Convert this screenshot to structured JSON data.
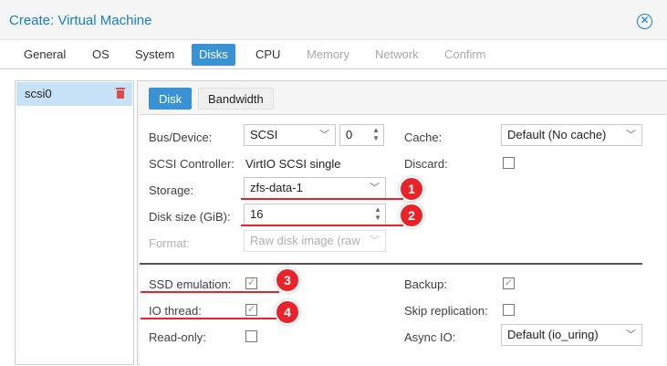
{
  "window": {
    "title": "Create: Virtual Machine"
  },
  "tabs": [
    {
      "label": "General",
      "state": "normal"
    },
    {
      "label": "OS",
      "state": "normal"
    },
    {
      "label": "System",
      "state": "normal"
    },
    {
      "label": "Disks",
      "state": "active"
    },
    {
      "label": "CPU",
      "state": "normal"
    },
    {
      "label": "Memory",
      "state": "disabled"
    },
    {
      "label": "Network",
      "state": "disabled"
    },
    {
      "label": "Confirm",
      "state": "disabled"
    }
  ],
  "disk_list": {
    "items": [
      {
        "label": "scsi0"
      }
    ]
  },
  "subtabs": [
    {
      "label": "Disk"
    },
    {
      "label": "Bandwidth"
    }
  ],
  "form": {
    "bus_device": {
      "label": "Bus/Device:",
      "bus": "SCSI",
      "device": "0"
    },
    "scsi_controller": {
      "label": "SCSI Controller:",
      "value": "VirtIO SCSI single"
    },
    "storage": {
      "label": "Storage:",
      "value": "zfs-data-1"
    },
    "disk_size": {
      "label": "Disk size (GiB):",
      "value": "16"
    },
    "format": {
      "label": "Format:",
      "value": "Raw disk image (raw"
    },
    "cache": {
      "label": "Cache:",
      "value": "Default (No cache)"
    },
    "discard": {
      "label": "Discard:",
      "checked": false
    },
    "ssd_emulation": {
      "label": "SSD emulation:",
      "checked": true
    },
    "io_thread": {
      "label": "IO thread:",
      "checked": true
    },
    "read_only": {
      "label": "Read-only:",
      "checked": false
    },
    "backup": {
      "label": "Backup:",
      "checked": true
    },
    "skip_replication": {
      "label": "Skip replication:",
      "checked": false
    },
    "async_io": {
      "label": "Async IO:",
      "value": "Default (io_uring)"
    }
  },
  "annotations": {
    "markers": [
      "1",
      "2",
      "3",
      "4"
    ],
    "color": "#e8232a"
  },
  "colors": {
    "accent": "#157fcc",
    "active_tab": "#3892d4",
    "selected_row": "#c7e1f6"
  }
}
